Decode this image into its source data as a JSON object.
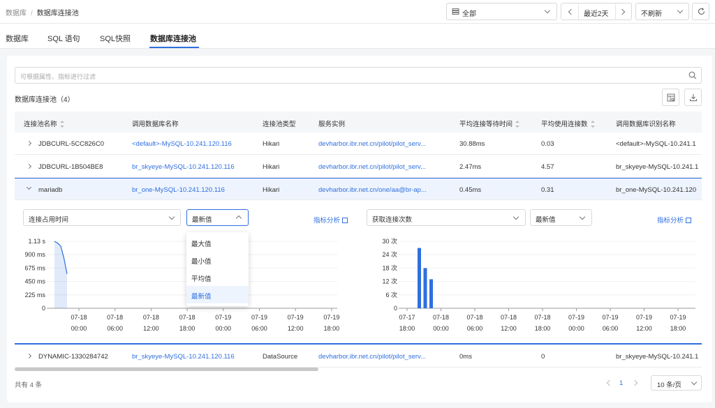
{
  "breadcrumb": {
    "root": "数据库",
    "separator": "/",
    "current": "数据库连接池"
  },
  "toolbar": {
    "scope_select": "全部",
    "time_range": "最近2天",
    "refresh_mode": "不刷新"
  },
  "tabs": [
    {
      "label": "数据库"
    },
    {
      "label": "SQL 语句"
    },
    {
      "label": "SQL快照"
    },
    {
      "label": "数据库连接池",
      "active": true
    }
  ],
  "filter": {
    "placeholder": "可根据属性、指标进行过滤"
  },
  "section": {
    "title": "数据库连接池（4）"
  },
  "table": {
    "columns": [
      "连接池名称",
      "调用数据库名称",
      "连接池类型",
      "服务实例",
      "平均连接等待时间",
      "平均使用连接数",
      "调用数据库识别名称"
    ],
    "rows": [
      {
        "name": "JDBCURL-5CC826C0",
        "db": "<default>-MySQL-10.241.120.116",
        "type": "Hikari",
        "instance": "devharbor.ibr.net.cn/pilot/pilot_serv...",
        "wait": "30.88ms",
        "conns": "0.03",
        "db_id": "<default>-MySQL-10.241.1"
      },
      {
        "name": "JDBCURL-1B504BE8",
        "db": "br_skyeye-MySQL-10.241.120.116",
        "type": "Hikari",
        "instance": "devharbor.ibr.net.cn/pilot/pilot_serv...",
        "wait": "2.47ms",
        "conns": "4.57",
        "db_id": "br_skyeye-MySQL-10.241.1"
      },
      {
        "name": "mariadb",
        "db": "br_one-MySQL-10.241.120.116",
        "type": "Hikari",
        "instance": "devharbor.ibr.net.cn/one/aa@br-ap...",
        "wait": "0.45ms",
        "conns": "0.31",
        "db_id": "br_one-MySQL-10.241.120"
      },
      {
        "name": "DYNAMIC-1330284742",
        "db": "br_skyeye-MySQL-10.241.120.116",
        "type": "DataSource",
        "instance": "devharbor.ibr.net.cn/pilot/pilot_serv...",
        "wait": "0ms",
        "conns": "0",
        "db_id": "br_skyeye-MySQL-10.241.1"
      }
    ]
  },
  "expanded": {
    "left": {
      "metric_select": "连接占用时间",
      "agg_select": "最新值",
      "analysis_link": "指标分析",
      "dropdown_options": [
        "最大值",
        "最小值",
        "平均值",
        "最新值"
      ],
      "dropdown_selected": "最新值"
    },
    "right": {
      "metric_select": "获取连接次数",
      "agg_select": "最新值",
      "analysis_link": "指标分析"
    }
  },
  "chart_data": [
    {
      "type": "area",
      "y_tick_labels": [
        "0",
        "225 ms",
        "450 ms",
        "675 ms",
        "900 ms",
        "1.13 s"
      ],
      "ylim": [
        0,
        1130
      ],
      "x_tick_labels": [
        [
          "07-18",
          "00:00"
        ],
        [
          "07-18",
          "06:00"
        ],
        [
          "07-18",
          "12:00"
        ],
        [
          "07-18",
          "18:00"
        ],
        [
          "07-19",
          "00:00"
        ],
        [
          "07-19",
          "06:00"
        ],
        [
          "07-19",
          "12:00"
        ],
        [
          "07-19",
          "18:00"
        ]
      ],
      "series": [
        {
          "values": [
            1130,
            1100,
            1050,
            850,
            580
          ]
        }
      ],
      "color": "#2f6fe0"
    },
    {
      "type": "bar",
      "y_tick_labels": [
        "0",
        "6 次",
        "12 次",
        "18 次",
        "24 次",
        "30 次"
      ],
      "ylim": [
        0,
        30
      ],
      "x_tick_labels": [
        [
          "07-17",
          "18:00"
        ],
        [
          "07-18",
          "00:00"
        ],
        [
          "07-18",
          "06:00"
        ],
        [
          "07-18",
          "12:00"
        ],
        [
          "07-18",
          "18:00"
        ],
        [
          "07-19",
          "00:00"
        ],
        [
          "07-19",
          "06:00"
        ],
        [
          "07-19",
          "12:00"
        ],
        [
          "07-19",
          "18:00"
        ]
      ],
      "series": [
        {
          "values": [
            27,
            18,
            13
          ]
        }
      ],
      "color": "#2f6fe0"
    }
  ],
  "pagination": {
    "total": "共有 4 条",
    "page": "1",
    "page_size": "10 条/页"
  }
}
